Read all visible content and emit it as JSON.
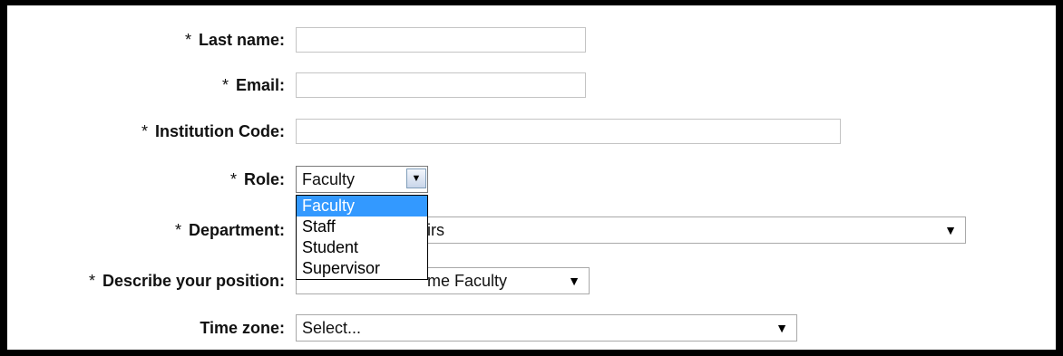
{
  "form": {
    "required_marker": "*",
    "last_name": {
      "label": "Last name:",
      "value": ""
    },
    "email": {
      "label": "Email:",
      "value": ""
    },
    "institution_code": {
      "label": "Institution Code:",
      "value": ""
    },
    "role": {
      "label": "Role:",
      "selected": "Faculty",
      "options": [
        "Faculty",
        "Staff",
        "Student",
        "Supervisor"
      ],
      "highlighted": "Faculty"
    },
    "department": {
      "label": "Department:",
      "selected_partial": "irs"
    },
    "position": {
      "label": "Describe your position:",
      "selected_partial": "me Faculty"
    },
    "time_zone": {
      "label": "Time zone:",
      "selected": "Select..."
    }
  },
  "icons": {
    "dropdown_arrow": "chevron-down-icon"
  },
  "colors": {
    "highlight": "#3399ff",
    "border": "#c4c4c4",
    "frame": "#000000"
  }
}
